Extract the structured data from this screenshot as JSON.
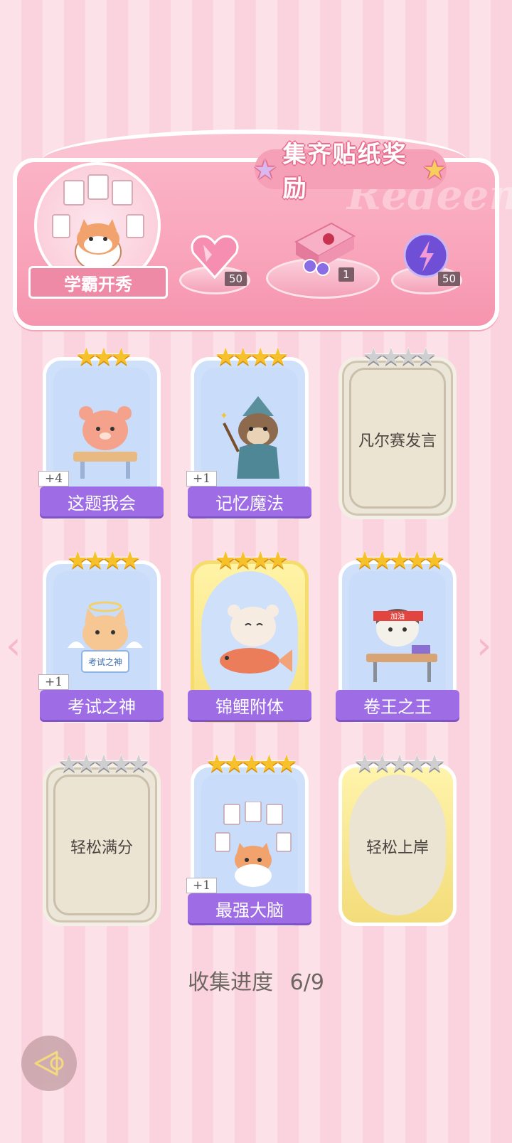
{
  "banner": {
    "title": "集齐贴纸奖励",
    "watermark": "Redeem",
    "badge_label": "学霸开秀",
    "rewards": [
      {
        "icon": "heart-gem-icon",
        "count": "50"
      },
      {
        "icon": "gift-box-icon",
        "count": "1"
      },
      {
        "icon": "lightning-orb-icon",
        "count": "50"
      }
    ]
  },
  "cards": [
    {
      "name": "这题我会",
      "stars": "★★★",
      "status": "collected",
      "plus": "+4"
    },
    {
      "name": "记忆魔法",
      "stars": "★★★★",
      "status": "collected",
      "plus": "+1"
    },
    {
      "name": "凡尔赛发言",
      "stars": "★★★★",
      "status": "locked"
    },
    {
      "name": "考试之神",
      "stars": "★★★★",
      "status": "collected",
      "plus": "+1",
      "mascot_text": "考试之神"
    },
    {
      "name": "锦鲤附体",
      "stars": "★★★★",
      "status": "collected"
    },
    {
      "name": "卷王之王",
      "stars": "★★★★★",
      "status": "collected",
      "mascot_text": "加油"
    },
    {
      "name": "轻松满分",
      "stars": "★★★★★",
      "status": "locked"
    },
    {
      "name": "最强大脑",
      "stars": "★★★★★",
      "status": "collected",
      "plus": "+1"
    },
    {
      "name": "轻松上岸",
      "stars": "★★★★★",
      "status": "locked"
    }
  ],
  "progress": {
    "label": "收集进度",
    "value": "6/9"
  },
  "nav": {
    "prev": "‹",
    "next": "›"
  },
  "colors": {
    "accent": "#9e6de6",
    "pink": "#f594ae",
    "gold_star": "#f6c12b"
  }
}
